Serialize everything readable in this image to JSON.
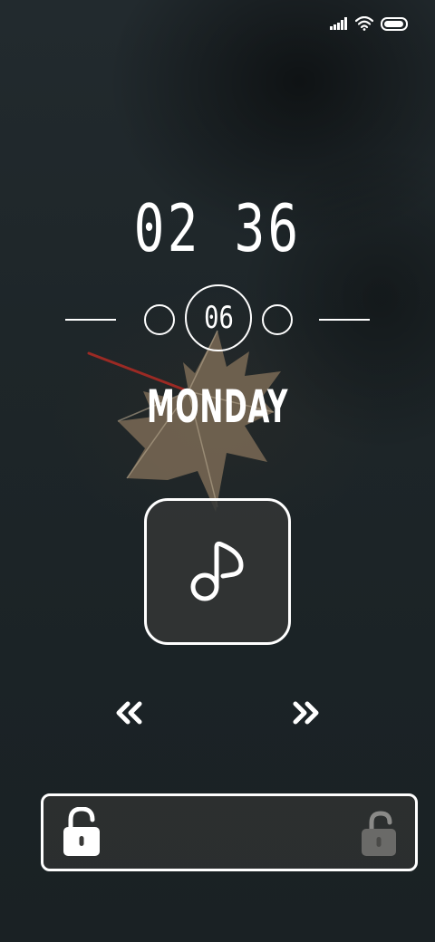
{
  "status_bar": {
    "icons": [
      "signal-icon",
      "wifi-icon",
      "battery-icon"
    ],
    "battery_level": 0.95
  },
  "lock_screen": {
    "time": "02 36",
    "day_of_month": "06",
    "weekday": "MONDAY"
  },
  "media": {
    "center_icon": "music-note-icon",
    "prev_icon": "double-chevron-left-icon",
    "next_icon": "double-chevron-right-icon"
  },
  "unlock": {
    "handle_icon": "unlocked-padlock-icon",
    "target_icon": "unlocked-padlock-faded-icon"
  },
  "colors": {
    "foreground": "#ffffff",
    "background": "#1b2124",
    "button_fill": "#343636"
  }
}
